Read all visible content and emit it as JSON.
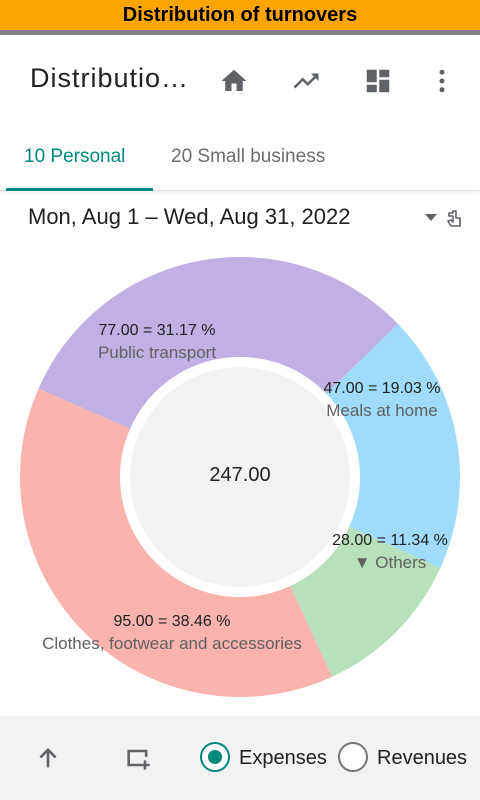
{
  "window": {
    "title": "Distribution of turnovers"
  },
  "appbar": {
    "title": "Distribution of turnovers",
    "icons": [
      "home-icon",
      "trending-up-icon",
      "dashboard-icon",
      "more-vert-icon"
    ]
  },
  "tabs": [
    {
      "label": "10 Personal",
      "active": true
    },
    {
      "label": "20 Small business",
      "active": false
    }
  ],
  "date_range": {
    "text": "Mon, Aug 1 – Wed, Aug 31, 2022"
  },
  "chart_data": {
    "type": "pie",
    "variant": "donut",
    "total": "247.00",
    "slices": [
      {
        "name": "Public transport",
        "value": 77.0,
        "value_text": "77.00 = 31.17 %",
        "color": "#c1b0e3"
      },
      {
        "name": "Meals at home",
        "value": 47.0,
        "value_text": "47.00 = 19.03 %",
        "color": "#9fdcfb"
      },
      {
        "name": "▼ Others",
        "value": 28.0,
        "value_text": "28.00 = 11.34 %",
        "color": "#b7e0bd"
      },
      {
        "name": "Clothes, footwear and accessories",
        "value": 95.0,
        "value_text": "95.00 = 38.46 %",
        "color": "#fab3ad"
      }
    ]
  },
  "bottom": {
    "icons": [
      "arrow-up-icon",
      "add-to-queue-icon"
    ],
    "radios": [
      {
        "label": "Expenses",
        "checked": true
      },
      {
        "label": "Revenues",
        "checked": false
      }
    ]
  },
  "colors": {
    "accent": "#00897b",
    "titlebar": "#ffa500"
  }
}
